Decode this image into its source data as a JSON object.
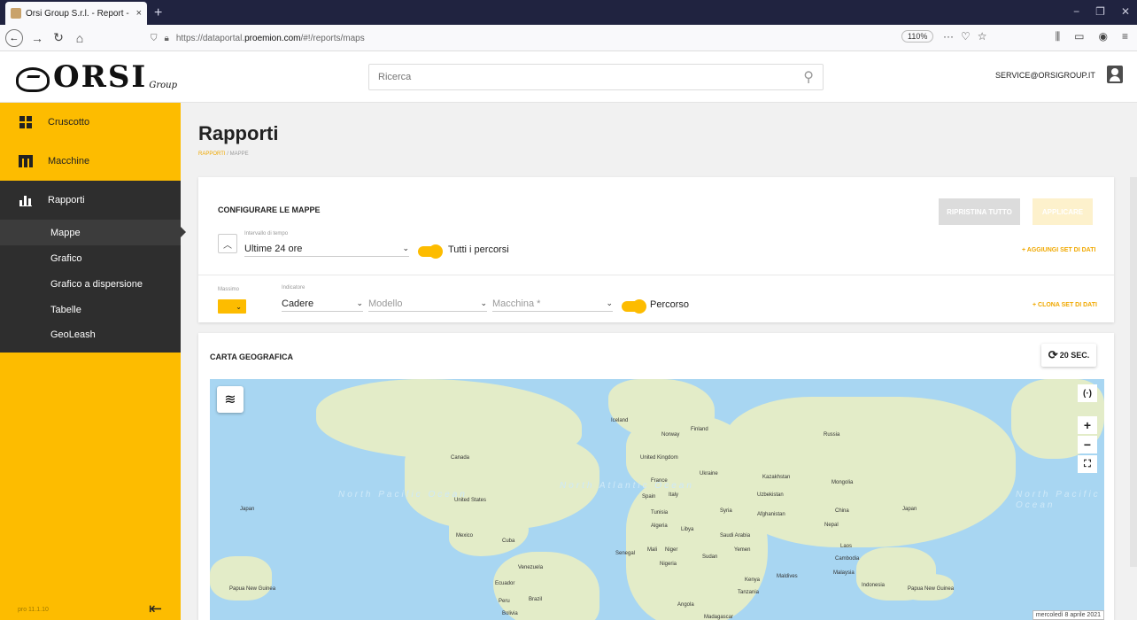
{
  "browser": {
    "tab_title": "Orsi Group S.r.l. - Report - Map",
    "tab_close": "×",
    "new_tab": "+",
    "url_prefix": "https://dataportal.",
    "url_domain": "proemion.com",
    "url_suffix": "/#!/reports/maps",
    "zoom": "110%",
    "win_min": "−",
    "win_max": "❐",
    "win_close": "✕"
  },
  "header": {
    "logo_text": "ORSI",
    "logo_sub": "Group",
    "search_placeholder": "Ricerca",
    "user": "SERVICE@ORSIGROUP.IT"
  },
  "sidebar": {
    "items": [
      {
        "label": "Cruscotto"
      },
      {
        "label": "Macchine"
      },
      {
        "label": "Rapporti"
      }
    ],
    "subitems": [
      {
        "label": "Mappe"
      },
      {
        "label": "Grafico"
      },
      {
        "label": "Grafico a dispersione"
      },
      {
        "label": "Tabelle"
      },
      {
        "label": "GeoLeash"
      }
    ],
    "version": "pro 11.1.10",
    "collapse": "⇤"
  },
  "page": {
    "title": "Rapporti",
    "crumb_root": "RAPPORTI",
    "crumb_sep": " / ",
    "crumb_leaf": "MAPPE"
  },
  "config": {
    "title": "CONFIGURARE LE MAPPE",
    "reset_label": "RIPRISTINA TUTTO",
    "apply_label": "APPLICARE",
    "time_label": "Intervallo di tempo",
    "time_value": "Ultime 24 ore",
    "all_routes": "Tutti i percorsi",
    "add_dataset": "+ AGGIUNGI SET DI DATI",
    "max_label": "Massimo",
    "indicator_label": "Indicatore",
    "indicator_value": "Cadere",
    "model_placeholder": "Modello",
    "machine_placeholder": "Macchina *",
    "route_label": "Percorso",
    "clone_dataset": "+ CLONA SET DI DATI",
    "accent": "#fdbc00"
  },
  "map": {
    "title": "CARTA GEOGRAFICA",
    "refresh_label": "20 SEC.",
    "zoom_in": "+",
    "zoom_out": "−",
    "locate": "(·)",
    "fullscreen": "⛶",
    "date_tag": "mercoledì 8 aprile 2021",
    "ocean_labels": [
      "North Pacific Ocean",
      "North Atlantic Ocean",
      "North Pacific Ocean"
    ],
    "labels": [
      "Iceland",
      "Norway",
      "Finland",
      "Russia",
      "Canada",
      "United Kingdom",
      "France",
      "Ukraine",
      "Kazakhstan",
      "Mongolia",
      "Spain",
      "Italy",
      "Uzbekistan",
      "United States",
      "Japan",
      "Tunisia",
      "Syria",
      "Afghanistan",
      "China",
      "Japan",
      "Algeria",
      "Libya",
      "Nepal",
      "Mexico",
      "Cuba",
      "Saudi Arabia",
      "Senegal",
      "Mali",
      "Niger",
      "Yemen",
      "Laos",
      "Sudan",
      "Nigeria",
      "Cambodia",
      "Venezuela",
      "Maldives",
      "Malaysia",
      "Ecuador",
      "Kenya",
      "Indonesia",
      "Papua New Guinea",
      "Papua New Guinea",
      "Peru",
      "Brazil",
      "Tanzania",
      "Angola",
      "Bolivia",
      "Madagascar"
    ]
  }
}
